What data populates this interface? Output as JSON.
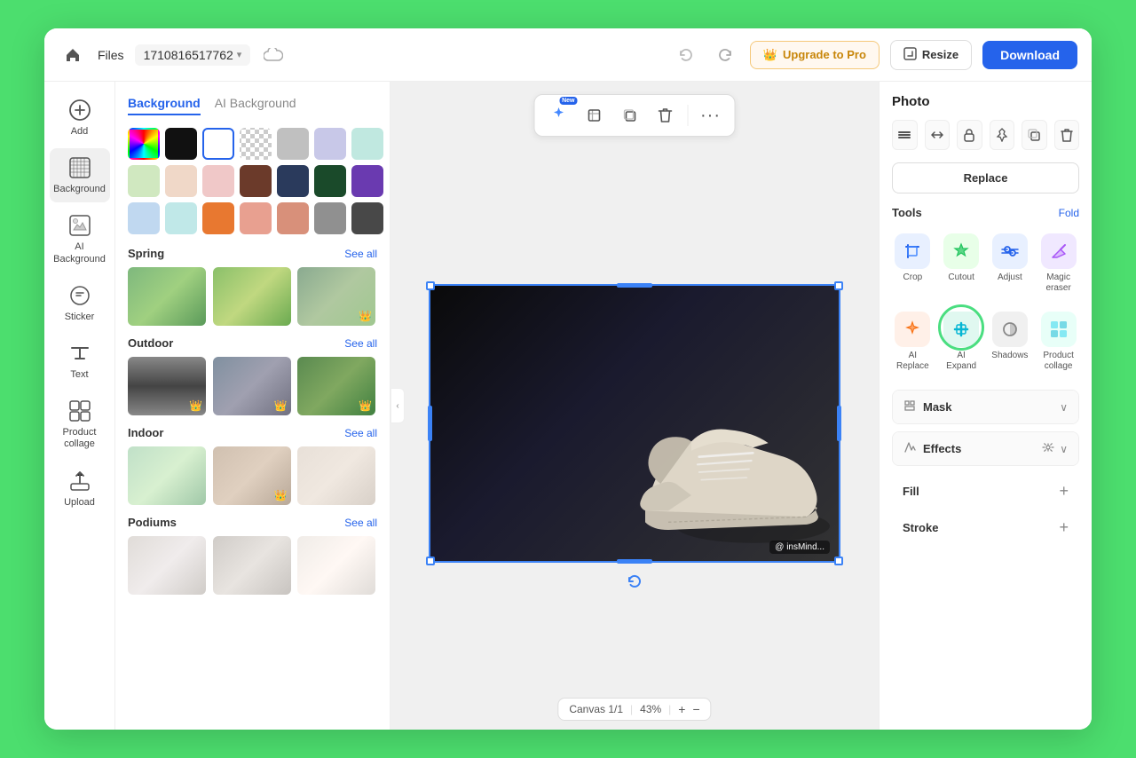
{
  "header": {
    "home_icon": "🏠",
    "files_label": "Files",
    "filename": "1710816517762",
    "cloud_icon": "☁",
    "undo_icon": "↩",
    "redo_icon": "↪",
    "upgrade_label": "Upgrade to Pro",
    "upgrade_icon": "👑",
    "resize_label": "Resize",
    "resize_icon": "⊡",
    "download_label": "Download"
  },
  "sidebar": {
    "items": [
      {
        "id": "add",
        "icon": "＋",
        "label": "Add"
      },
      {
        "id": "background",
        "icon": "▦",
        "label": "Background"
      },
      {
        "id": "ai-background",
        "icon": "✦",
        "label": "AI Background"
      },
      {
        "id": "sticker",
        "icon": "◎",
        "label": "Sticker"
      },
      {
        "id": "text",
        "icon": "T",
        "label": "Text"
      },
      {
        "id": "product-collage",
        "icon": "⊞",
        "label": "Product collage"
      },
      {
        "id": "upload",
        "icon": "⬆",
        "label": "Upload"
      }
    ]
  },
  "bg_panel": {
    "tab_background": "Background",
    "tab_ai": "AI Background",
    "section_spring": "Spring",
    "section_outdoor": "Outdoor",
    "section_indoor": "Indoor",
    "section_podiums": "Podiums",
    "see_all": "See all",
    "colors": [
      {
        "id": "gradient",
        "type": "gradient"
      },
      {
        "id": "black",
        "class": "s-black"
      },
      {
        "id": "white-selected",
        "class": "s-selected",
        "selected": true
      },
      {
        "id": "transparent",
        "class": "s-transparent checker"
      },
      {
        "id": "lgray",
        "class": "s-lgray"
      },
      {
        "id": "lavender",
        "class": "s-lavender"
      },
      {
        "id": "mint",
        "class": "s-mint"
      },
      {
        "id": "lgreen",
        "class": "s-lgreen"
      },
      {
        "id": "peach",
        "class": "s-peach"
      },
      {
        "id": "lpink",
        "class": "s-lpink"
      },
      {
        "id": "brown",
        "class": "s-brown"
      },
      {
        "id": "dblue",
        "class": "s-dblue"
      },
      {
        "id": "dgreen",
        "class": "s-dgreen"
      },
      {
        "id": "purple",
        "class": "s-purple"
      },
      {
        "id": "lblue",
        "class": "s-lblue"
      },
      {
        "id": "lteal",
        "class": "s-lteal"
      },
      {
        "id": "orange",
        "class": "s-orange"
      },
      {
        "id": "salmon",
        "class": "s-salmon"
      },
      {
        "id": "rose",
        "class": "s-rose"
      },
      {
        "id": "mgray",
        "class": "s-mgray"
      },
      {
        "id": "dgray",
        "class": "s-dgray"
      }
    ]
  },
  "canvas": {
    "toolbar_items": [
      {
        "id": "ai-tool",
        "icon": "✦",
        "new": true,
        "label": "AI"
      },
      {
        "id": "crop-tool",
        "icon": "⊡"
      },
      {
        "id": "copy-tool",
        "icon": "⧉"
      },
      {
        "id": "delete-tool",
        "icon": "🗑"
      },
      {
        "id": "more-tool",
        "icon": "···"
      }
    ],
    "watermark": "@ insMind...",
    "bottom_bar": {
      "page_label": "Canvas 1/1",
      "zoom": "43%",
      "icon1": "↺",
      "icon2": "⊞"
    }
  },
  "right_panel": {
    "title": "Photo",
    "icons": [
      "⊞",
      "⊡",
      "🔒",
      "📌",
      "⧉",
      "🗑"
    ],
    "replace_label": "Replace",
    "tools_label": "Tools",
    "fold_label": "Fold",
    "tools": [
      {
        "id": "crop",
        "icon": "✂",
        "label": "Crop",
        "color": "#e8f0ff"
      },
      {
        "id": "cutout",
        "icon": "✦",
        "label": "Cutout",
        "color": "#e8ffe8"
      },
      {
        "id": "adjust",
        "icon": "⊕",
        "label": "Adjust",
        "color": "#e8f0ff"
      },
      {
        "id": "magic-eraser",
        "icon": "✦",
        "label": "Magic eraser",
        "color": "#f0e8ff"
      },
      {
        "id": "ai-replace",
        "icon": "✦",
        "label": "AI Replace",
        "color": "#fff0e8"
      },
      {
        "id": "ai-expand",
        "icon": "⊞",
        "label": "AI Expand",
        "color": "#e8f8ff",
        "active": true
      },
      {
        "id": "shadows",
        "icon": "◑",
        "label": "Shadows",
        "color": "#f0f0f0"
      },
      {
        "id": "product-collage",
        "icon": "⊞",
        "label": "Product collage",
        "color": "#e8fff8"
      }
    ],
    "mask_label": "Mask",
    "effects_label": "Effects",
    "fill_label": "Fill",
    "stroke_label": "Stroke"
  }
}
